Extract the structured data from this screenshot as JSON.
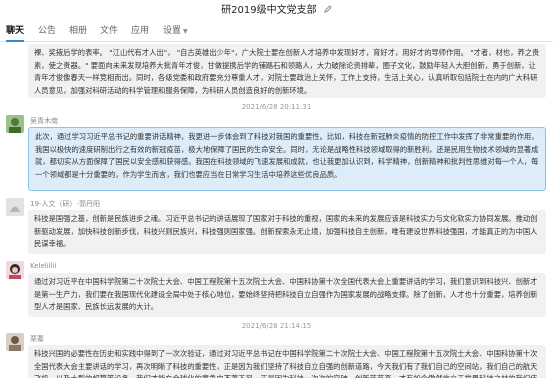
{
  "window": {
    "title": "研2019级中文党支部",
    "edit_icon": "pencil-icon"
  },
  "tabs": [
    {
      "label": "聊天",
      "active": true
    },
    {
      "label": "公告"
    },
    {
      "label": "相册"
    },
    {
      "label": "文件"
    },
    {
      "label": "应用"
    },
    {
      "label": "设置"
    }
  ],
  "messages": [
    {
      "text": "裸、奖掖后学的表率。 \"江山代有才人出\"， \"自古英雄出少年\"，广大院士要在创新人才培养中发现好才，育好才，用好才的导师作用。 \"才者，材也，养之贵素，使之贵器。\" 要面向未来发现培养大批青年才俊，甘做提携后学的铺路石和领路人，大力破除论资排辈，圈子文化，鼓励年轻人大胆创新，勇于创新，让青年才俊像春天一样竞相而出。同时，各级党委和政府要充分尊重人才，对院士要政治上关怀，工作上支持，生活上关心，认真听取包括院士在内的广大科研人员意见，加强对科研活动的科学管理和服务保障，为科研人员创造良好的创新环境。"
    },
    {
      "time": "2021/6/28 20:11:31",
      "sender": "吴青木南",
      "text": "此次，通过学习习近平总书记的重要讲话精神，我更进一步体会到了科技对我国的重要性。比如，科技在新冠肺炎疫情的防控工作中发挥了非常重要的作用，我国以极快的速度研制出行之有效的新冠疫苗，极大地保障了国民的生命安全。同时，无论是战略性科技领域取得的新胜利，还是民用生物技术领域的显著成就，都切实从方面保障了国民以安全感和获得感。我国在科技领域的飞速发展和成就，也让我更加认识到，科学精神，创新精神和批判性思维对每一个人，每一个领域都是十分重要的，作为学生而言，我们也要应当在日常学习生活中培养这些优良品质。"
    },
    {
      "sender": "19-人文（研）-郭丹阳",
      "text": "科技是国强之基，创新是民族进步之魂。习近平总书记的讲话展现了国家对于科技的重视，国家的未来的发展应该是科技实力与文化软实力协同发展。推动创新驱动发展，加快科技创新步伐，科技兴则民族兴，科技强则国家强。创新探索永无止境，加强科技自主创新，唯有建设世界科技强国，才能真正的为中国人民谋幸福。"
    },
    {
      "sender": "Kelelillii",
      "text": "通过对习近平在中国科学院第二十次院士大会、中国工程院第十五次院士大会、中国科协第十次全国代表大会上重要讲话的学习，我们意识到科技兴、创新才是第一生产力，我们要在我国现代化建设全局中处于核心地位，要始终坚持把科技自立自强作为国家发展的战略支撑。除了创新，人才也十分重要，培养创新型人才是国家、民族长远发展的大计。"
    },
    {
      "time": "2021/6/28 21:14:15",
      "sender": "栗蓁",
      "text": "科技兴国的必要性在历史和实践中得到了一次次验证，通过对习近平总书记在中国科学院第二十次院士大会、中国工程院第十五次院士大会、中国科协第十次全国代表大会主要讲话的学习，再次明晰了科技的重要性，正是因为我们坚持了科技自立自强的创新道路，今天我们有了我们自己的空间站，我们自己的航天飞机，以及大型的超算等设备，我们才能在全球化的竞争中不落下风。正是因为科技一次次的突破，创新节节高，才有如今傲然屹立于世界科技之林的我们伟大祖国，科技生产力和人才是如今最重大的宝藏，学习中文的我们也可以思考科技的进步，用所学探索国家。"
    }
  ]
}
